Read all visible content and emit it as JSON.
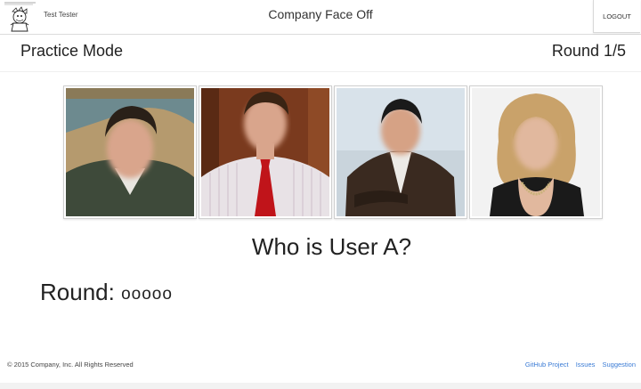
{
  "header": {
    "user_name": "Test Tester",
    "app_title": "Company Face Off",
    "logout_label": "LOGOUT"
  },
  "subheader": {
    "mode": "Practice Mode",
    "round": "Round 1/5"
  },
  "photos": [
    {
      "bg": "#b59a6e",
      "shirt": "#3e4a3a",
      "hair": "#2a2018"
    },
    {
      "bg": "#7a3a1e",
      "shirt": "#e8e2e6",
      "hair": "#3a2414"
    },
    {
      "bg": "#d8e2ea",
      "shirt": "#3a2a20",
      "hair": "#1a1a1a"
    },
    {
      "bg": "#f2f2f2",
      "shirt": "#1a1a1a",
      "hair": "#c9a26a"
    }
  ],
  "question": "Who is User A?",
  "round_progress": {
    "label": "Round:",
    "dots": "ooooo"
  },
  "footer": {
    "copyright": "© 2015 Company, Inc. All Rights Reserved",
    "links": [
      "GitHub Project",
      "Issues",
      "Suggestion"
    ]
  }
}
